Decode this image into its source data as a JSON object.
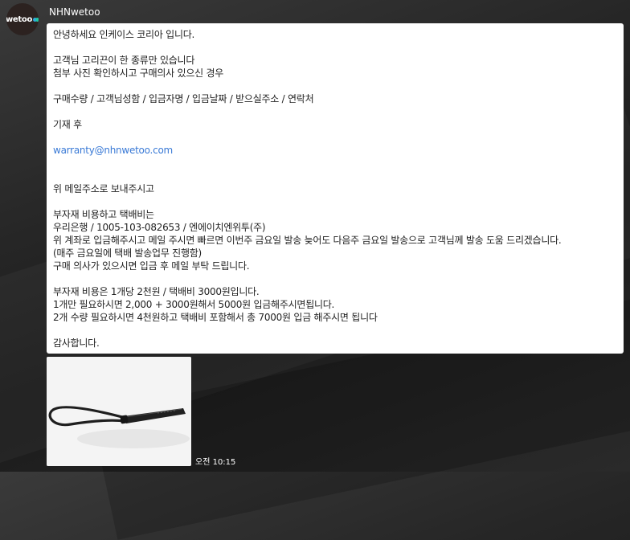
{
  "sender": {
    "name": "NHNwetoo",
    "avatar_logo_text": "wetoo"
  },
  "message": {
    "line1": "안녕하세요 인케이스 코리아 입니다.",
    "line2": "고객님 고리끈이 한 종류만 있습니다",
    "line3": "첨부 사진 확인하시고 구매의사 있으신 경우",
    "line4": "구매수량 / 고객님성함 / 입금자명 / 입금날짜 / 받으실주소 / 연락처",
    "line5": "기재 후",
    "email": "warranty@nhnwetoo.com",
    "line6": "위 메일주소로 보내주시고",
    "line7": "부자재 비용하고 택배비는",
    "line8": "우리은행 / 1005-103-082653 /  엔에이치엔위투(주)",
    "line9": "위 계좌로 입금해주시고 메일 주시면 빠르면 이번주 금요일 발송 늦어도 다음주 금요일 발송으로 고객님께 발송 도움 드리겠습니다.",
    "line10": "(매주 금요일에 택배 발송업무 진행함)",
    "line11": "구매 의사가 있으시면 입금 후 메일 부탁 드립니다.",
    "line12": "부자재 비용은 1개당 2천원 / 택배비 3000원입니다.",
    "line13": "1개만 필요하시면 2,000 + 3000원해서 5000원 입금해주시면됩니다.",
    "line14": "2개 수량 필요하시면 4천원하고 택배비 포함해서 총 7000원 입금 해주시면 됩니다",
    "line15": "감사합니다."
  },
  "attachment": {
    "icon": "photo-thumbnail"
  },
  "timestamp": "오전 10:15",
  "colors": {
    "background": "#262626",
    "bubble": "#ffffff",
    "link": "#3a7ad6",
    "logo_accent": "#2fa7e0"
  }
}
